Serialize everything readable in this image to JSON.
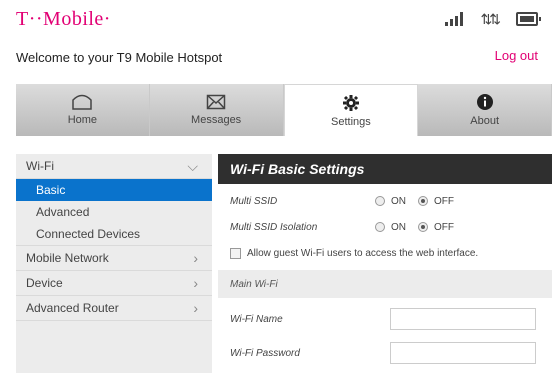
{
  "brand": {
    "logo_text": "T··Mobile·",
    "color": "#e20074"
  },
  "status": {
    "signal_icon": "signal-bars-icon",
    "data_icon": "data-arrows-icon",
    "battery_icon": "battery-icon"
  },
  "header": {
    "welcome": "Welcome to your T9 Mobile Hotspot",
    "logout": "Log out"
  },
  "tabs": [
    {
      "label": "Home",
      "icon": "home-icon",
      "active": false
    },
    {
      "label": "Messages",
      "icon": "envelope-icon",
      "active": false
    },
    {
      "label": "Settings",
      "icon": "gear-icon",
      "active": true
    },
    {
      "label": "About",
      "icon": "info-icon",
      "active": false
    }
  ],
  "sidebar": {
    "wifi": "Wi-Fi",
    "wifi_sub": [
      "Basic",
      "Advanced",
      "Connected Devices"
    ],
    "mobile_network": "Mobile Network",
    "device": "Device",
    "advanced_router": "Advanced Router"
  },
  "main": {
    "title": "Wi-Fi Basic Settings",
    "multi_ssid": {
      "label": "Multi SSID",
      "on": "ON",
      "off": "OFF",
      "selected": "OFF"
    },
    "multi_ssid_isolation": {
      "label": "Multi SSID Isolation",
      "on": "ON",
      "off": "OFF",
      "selected": "OFF"
    },
    "guest_access": "Allow guest Wi-Fi users to access the web interface.",
    "section_main": "Main Wi-Fi",
    "wifi_name_label": "Wi-Fi Name",
    "wifi_name_value": "",
    "wifi_password_label": "Wi-Fi Password",
    "wifi_password_value": ""
  }
}
